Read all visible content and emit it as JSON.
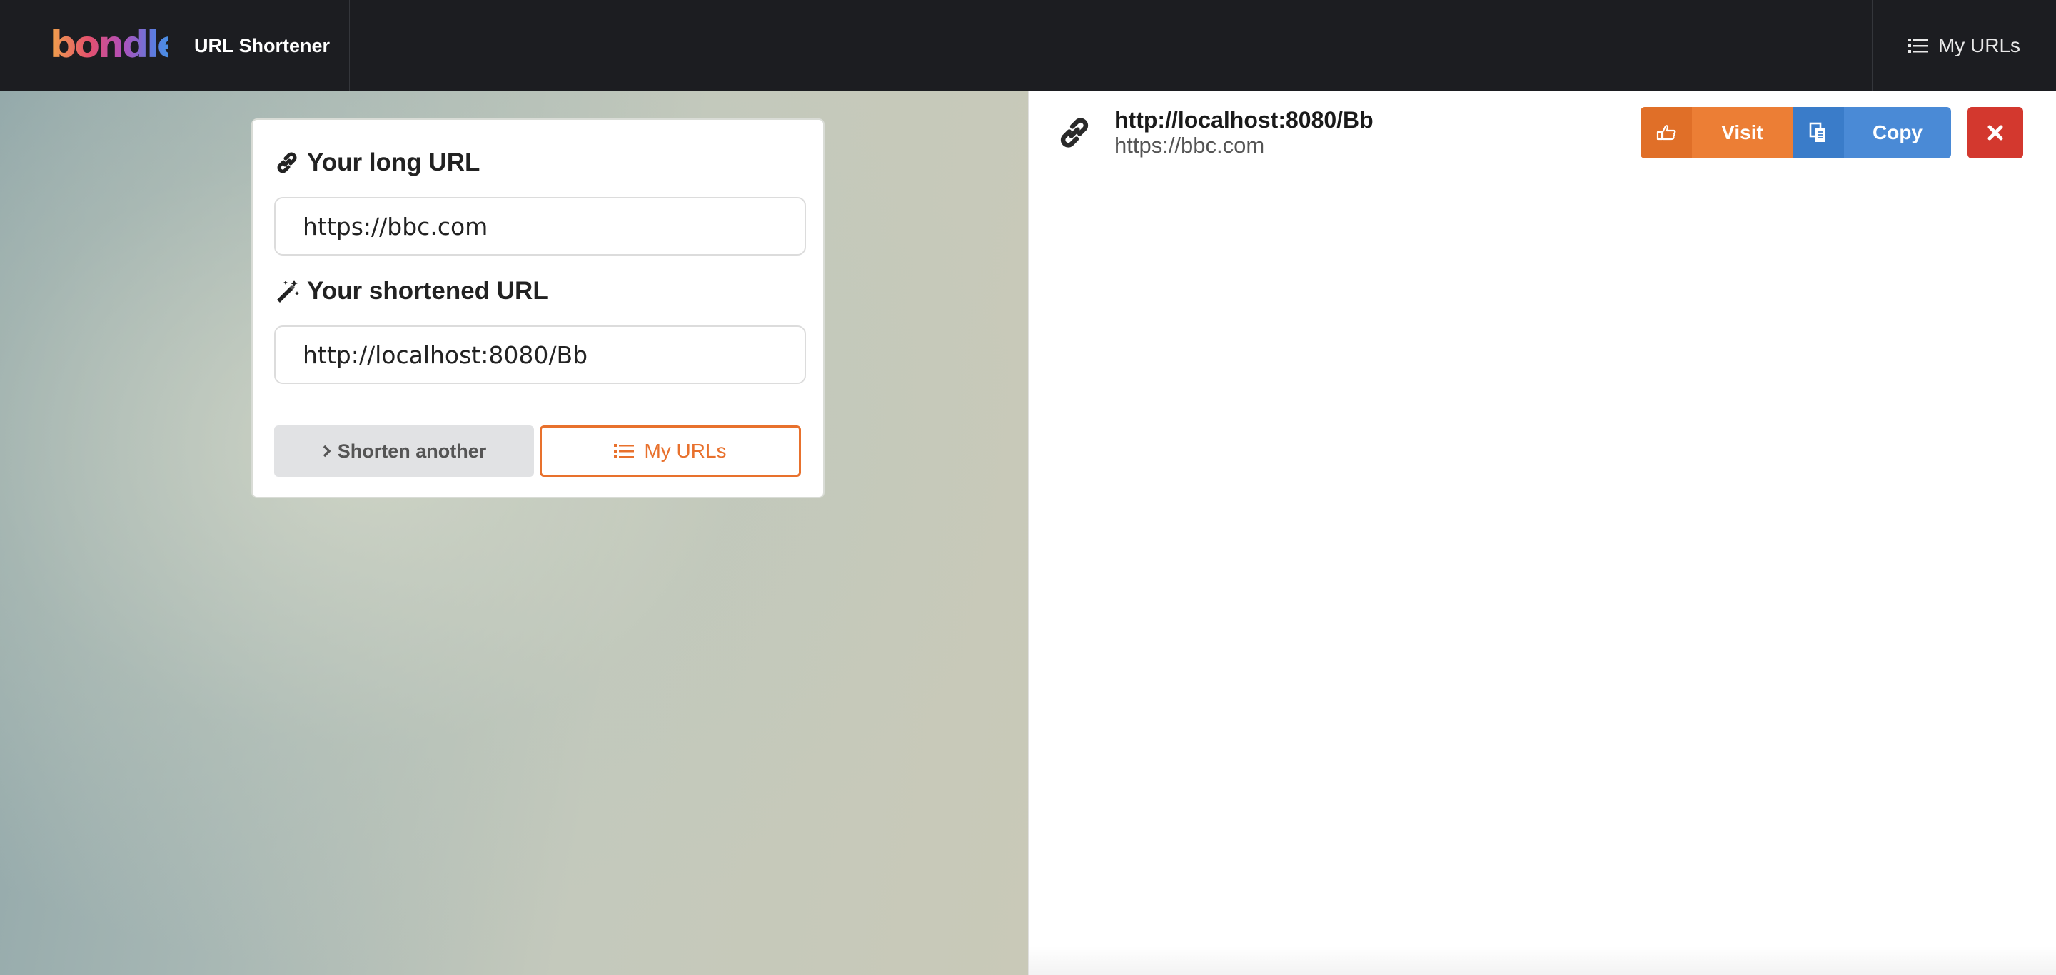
{
  "navbar": {
    "logo_text": "bondle",
    "app_title": "URL Shortener",
    "my_urls_label": "My URLs"
  },
  "form": {
    "long_url_label": "Your long URL",
    "long_url_value": "https://bbc.com",
    "short_url_label": "Your shortened URL",
    "short_url_value": "http://localhost:8080/Bb",
    "shorten_another_label": "Shorten another",
    "my_urls_label": "My URLs"
  },
  "url_list": [
    {
      "short_url": "http://localhost:8080/Bb",
      "long_url": "https://bbc.com",
      "visit_label": "Visit",
      "copy_label": "Copy"
    }
  ],
  "colors": {
    "navbar_bg": "#1c1d21",
    "accent_orange": "#ec7e35",
    "accent_blue": "#4a8ad6",
    "danger_red": "#d3382e"
  }
}
